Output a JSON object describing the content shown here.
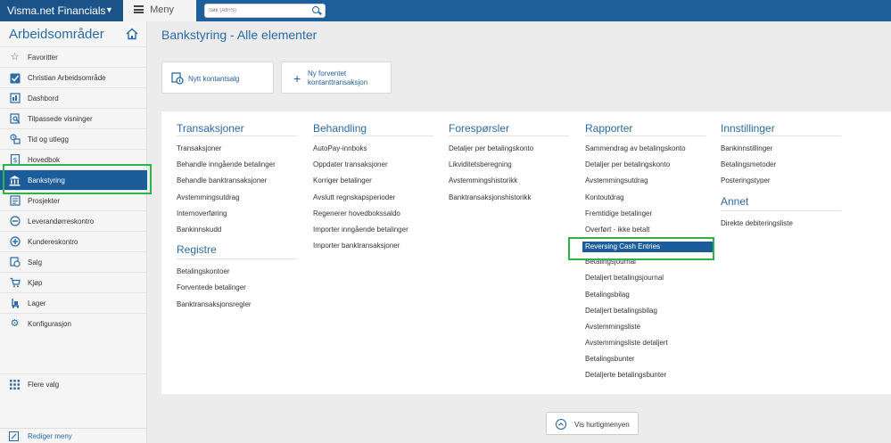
{
  "topbar": {
    "app_name": "Visma.net Financials",
    "menu_label": "Meny",
    "search_placeholder": "Søk (Alt+S)"
  },
  "sidebar": {
    "title": "Arbeidsområder",
    "items": [
      {
        "label": "Favoritter",
        "icon": "star-icon"
      },
      {
        "label": "Christian Arbeidsområde",
        "icon": "checkbox-icon"
      },
      {
        "label": "Dashbord",
        "icon": "dashboard-icon"
      },
      {
        "label": "Tilpassede visninger",
        "icon": "custom-view-icon"
      },
      {
        "label": "Tid og utlegg",
        "icon": "time-expense-icon"
      },
      {
        "label": "Hovedbok",
        "icon": "ledger-icon"
      },
      {
        "label": "Bankstyring",
        "icon": "bank-icon"
      },
      {
        "label": "Prosjekter",
        "icon": "projects-icon"
      },
      {
        "label": "Leverandørreskontro",
        "icon": "minus-circle-icon"
      },
      {
        "label": "Kundereskontro",
        "icon": "plus-circle-icon"
      },
      {
        "label": "Salg",
        "icon": "sales-icon"
      },
      {
        "label": "Kjøp",
        "icon": "cart-icon"
      },
      {
        "label": "Lager",
        "icon": "forklift-icon"
      },
      {
        "label": "Konfigurasjon",
        "icon": "gear-icon"
      }
    ],
    "more_label": "Flere valg",
    "edit_label": "Rediger meny"
  },
  "main": {
    "title": "Bankstyring - Alle elementer",
    "quick_buttons": [
      {
        "label": "Nytt kontantsalg"
      },
      {
        "line1": "Ny forventet",
        "line2": "kontanttransaksjon"
      }
    ],
    "hurtig_label": "Vis hurtigmenyen"
  },
  "columns": {
    "transaksjoner": {
      "title": "Transaksjoner",
      "items": [
        "Transaksjoner",
        "Behandle inngående betalinger",
        "Behandle banktransaksjoner",
        "Avstemmingsutdrag",
        "Internoverføring",
        "Bankinnskudd"
      ]
    },
    "registre": {
      "title": "Registre",
      "items": [
        "Betalingskontoer",
        "Forventede betalinger",
        "Banktransaksjonsregler"
      ]
    },
    "behandling": {
      "title": "Behandling",
      "items": [
        "AutoPay-innboks",
        "Oppdater transaksjoner",
        "Korriger betalinger",
        "Avslutt regnskapsperioder",
        "Regenerer hovedbokssaldo",
        "Importer inngående betalinger",
        "Importer banktransaksjoner"
      ]
    },
    "foresporsler": {
      "title": "Forespørsler",
      "items": [
        "Detaljer per betalingskonto",
        "Likviditetsberegning",
        "Avstemmingshistorikk",
        "Banktransaksjonshistorikk"
      ]
    },
    "rapporter": {
      "title": "Rapporter",
      "items": [
        "Sammendrag av betalingskonto",
        "Detaljer per betalingskonto",
        "Avstemmingsutdrag",
        "Kontoutdrag",
        "Fremtidige betalinger",
        "Overført - ikke betalt",
        "Reversing Cash Entries",
        "Betalingsjournal",
        "Detaljert betalingsjournal",
        "Betalingsbilag",
        "Detaljert betalingsbilag",
        "Avstemmingsliste",
        "Avstemmingsliste detaljert",
        "Betalingsbunter",
        "Detaljerte betalingsbunter"
      ]
    },
    "innstillinger": {
      "title": "Innstillinger",
      "items": [
        "Bankinnstillinger",
        "Betalingsmetoder",
        "Posteringstyper"
      ]
    },
    "annet": {
      "title": "Annet",
      "items": [
        "Direkte debiteringsliste"
      ]
    }
  },
  "colors": {
    "brand_blue": "#1f5f99",
    "accent_blue": "#2a6aa5",
    "selected_bg": "#1b5d9a",
    "highlight_green": "#2eb24a"
  }
}
